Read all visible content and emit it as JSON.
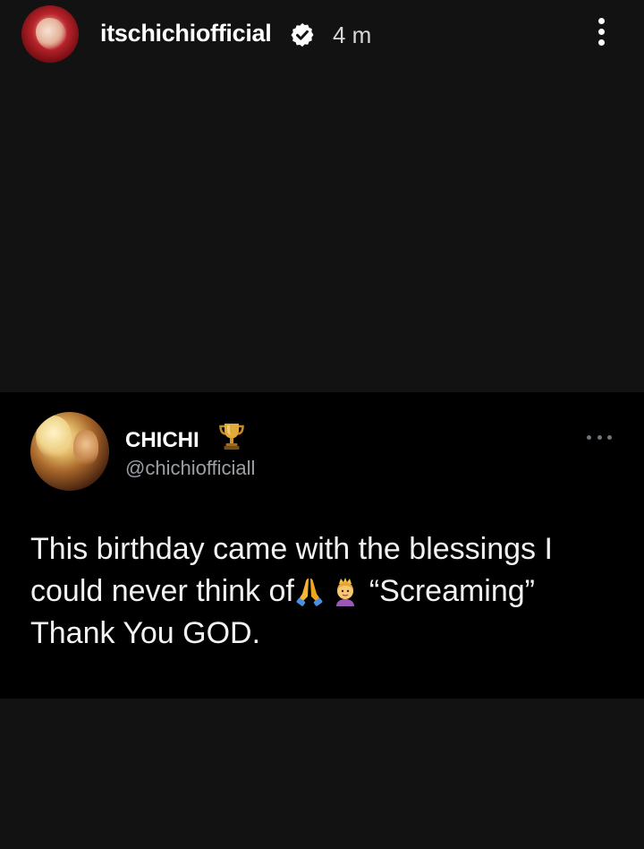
{
  "story": {
    "username": "itschichiofficial",
    "time": "4 m",
    "icons": {
      "avatar": "profile-photo",
      "verified": "verified-badge-icon",
      "more": "more-vertical-icon"
    }
  },
  "tweet": {
    "display_name": "CHICHI",
    "handle": "@chichiofficiall",
    "text_line1": "This birthday came with the blessings I",
    "text_line2a": "could never think of",
    "text_line2b": "“Screaming”",
    "text_line3": "Thank You GOD.",
    "icons": {
      "name_badge": "trophy-icon",
      "more": "more-horizontal-icon",
      "emoji1": "folded-hands-emoji",
      "emoji2": "princess-emoji"
    }
  },
  "colors": {
    "background": "#121212",
    "card": "#000000",
    "text": "#ffffff",
    "handle": "#9aa0a6"
  }
}
